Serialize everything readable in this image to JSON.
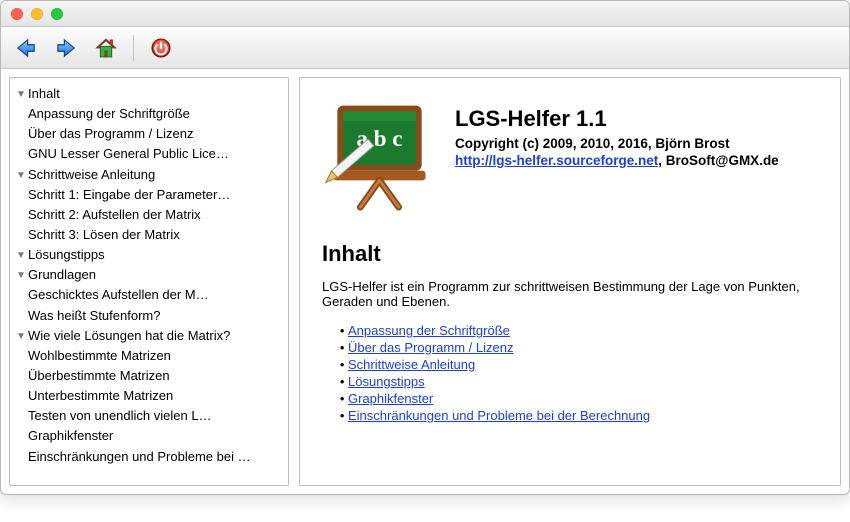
{
  "toolbar": {
    "back": "back-icon",
    "forward": "forward-icon",
    "home": "home-icon",
    "power": "power-icon"
  },
  "tree": [
    {
      "level": 1,
      "expandable": true,
      "label": "Inhalt"
    },
    {
      "level": 2,
      "label": "Anpassung der Schriftgröße"
    },
    {
      "level": 2,
      "label": "Über das Programm / Lizenz"
    },
    {
      "level": 2,
      "label": "GNU Lesser General Public Lice…"
    },
    {
      "level": 1,
      "expandable": true,
      "label": "Schrittweise Anleitung"
    },
    {
      "level": 2,
      "label": "Schritt 1: Eingabe der Parameter…"
    },
    {
      "level": 2,
      "label": "Schritt 2: Aufstellen der Matrix"
    },
    {
      "level": 2,
      "label": "Schritt 3: Lösen der Matrix"
    },
    {
      "level": 1,
      "expandable": true,
      "label": "Lösungstipps"
    },
    {
      "level": "1b",
      "expandable": true,
      "label": "Grundlagen"
    },
    {
      "level": 3,
      "label": "Geschicktes Aufstellen der M…"
    },
    {
      "level": 3,
      "label": "Was heißt Stufenform?"
    },
    {
      "level": "1b",
      "expandable": true,
      "label": "Wie viele Lösungen hat die Matrix?"
    },
    {
      "level": 3,
      "label": "Wohlbestimmte Matrizen"
    },
    {
      "level": 3,
      "label": "Überbestimmte Matrizen"
    },
    {
      "level": 3,
      "label": "Unterbestimmte Matrizen"
    },
    {
      "level": 2,
      "label": "Testen von unendlich vielen L…"
    },
    {
      "level": 1,
      "label": "Graphikfenster"
    },
    {
      "level": 1,
      "label": "Einschränkungen und Probleme bei …"
    }
  ],
  "main": {
    "title": "LGS-Helfer 1.1",
    "copyright": "Copyright (c) 2009, 2010, 2016, Björn Brost",
    "url_label": "http://lgs-helfer.sourceforge.net",
    "email_suffix": ", BroSoft@GMX.de",
    "section_heading": "Inhalt",
    "description": "LGS-Helfer ist ein Programm zur schrittweisen Bestimmung der Lage von Punkten, Geraden und Ebenen.",
    "links": [
      "Anpassung der Schriftgröße",
      "Über das Programm / Lizenz",
      "Schrittweise Anleitung",
      "Lösungstipps",
      "Graphikfenster",
      "Einschränkungen und Probleme bei der Berechnung"
    ]
  }
}
